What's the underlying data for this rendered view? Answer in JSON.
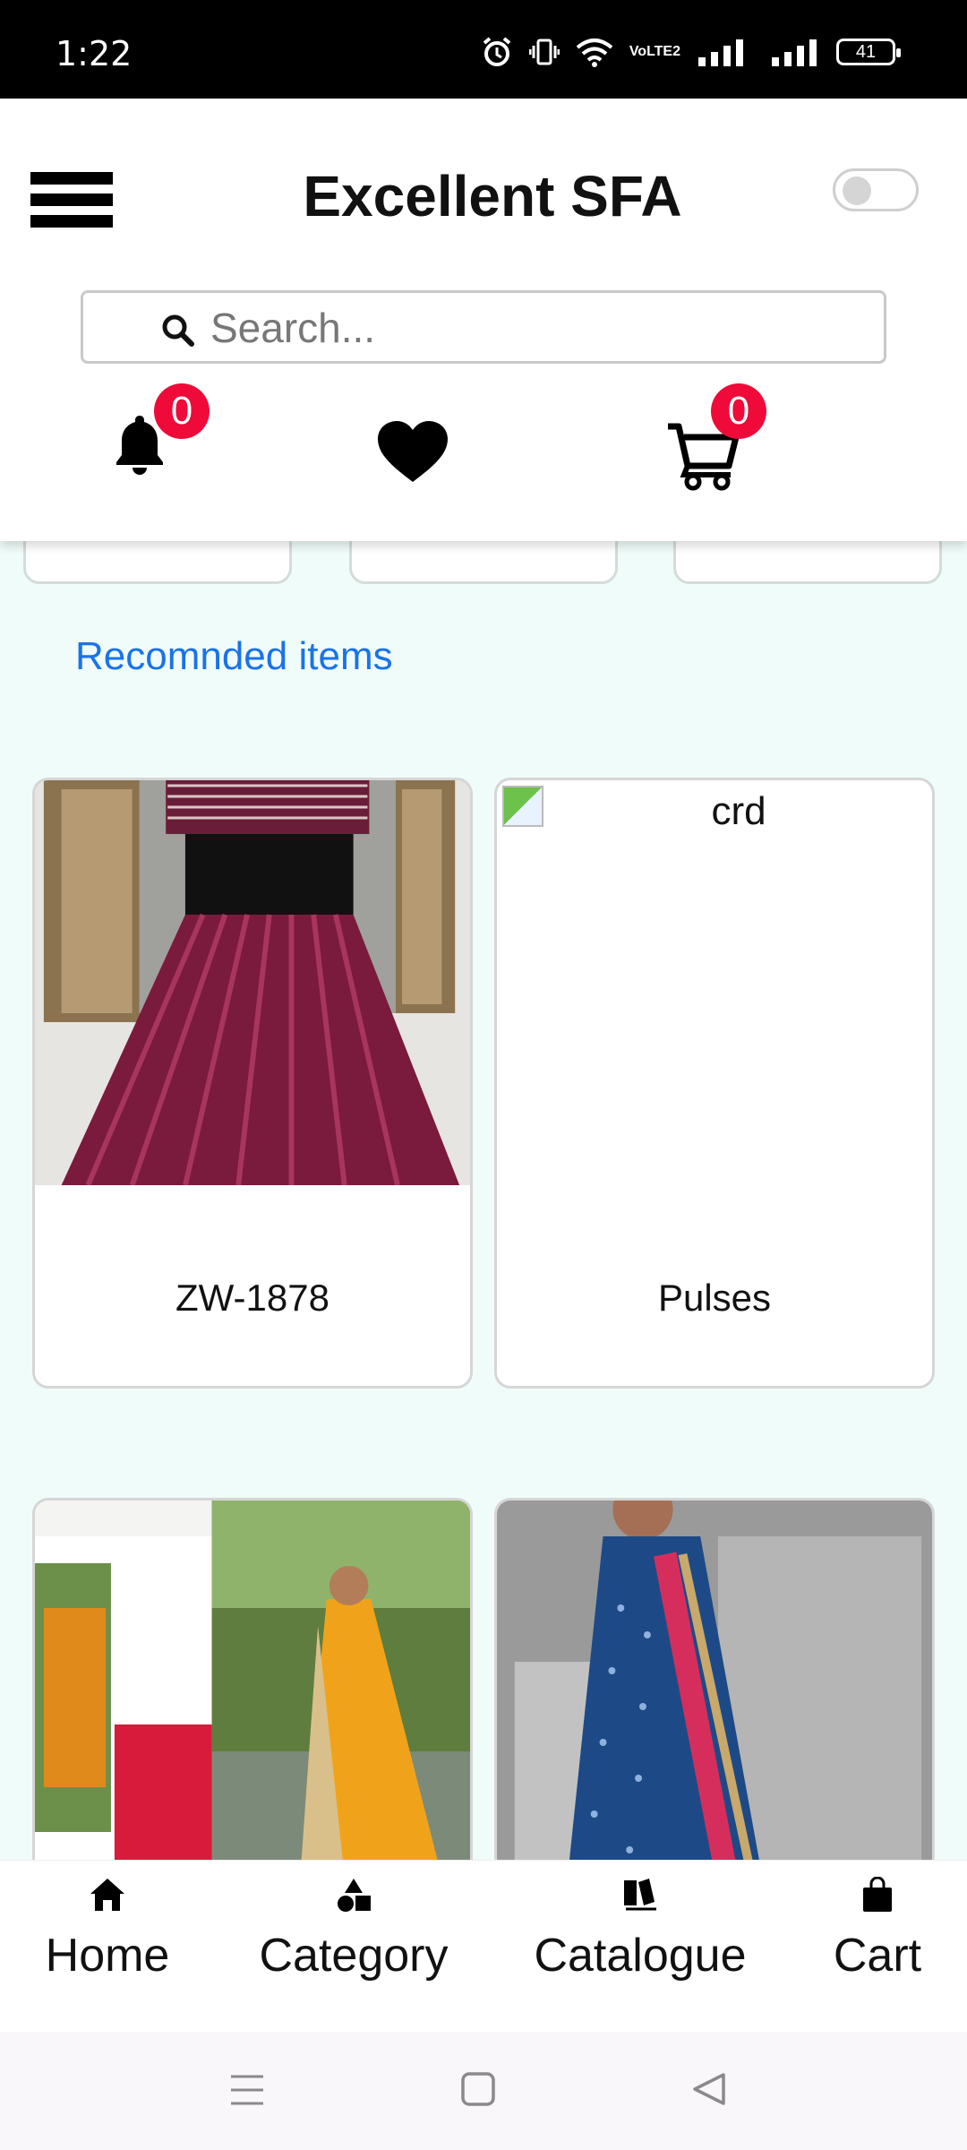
{
  "status_bar": {
    "time": "1:22",
    "battery": "41",
    "network_label": "VoLTE2"
  },
  "header": {
    "title": "Excellent SFA",
    "search_placeholder": "Search...",
    "notification_count": "0",
    "cart_count": "0"
  },
  "section": {
    "title": "Recomnded items"
  },
  "products": [
    {
      "label": "ZW-1878"
    },
    {
      "label": "Pulses",
      "alt": "crd"
    },
    {
      "label": ""
    },
    {
      "label": ""
    }
  ],
  "bottom_nav": [
    {
      "label": "Home",
      "icon": "home-icon"
    },
    {
      "label": "Category",
      "icon": "category-icon"
    },
    {
      "label": "Catalogue",
      "icon": "catalogue-icon"
    },
    {
      "label": "Cart",
      "icon": "shopping-bag-icon"
    }
  ]
}
